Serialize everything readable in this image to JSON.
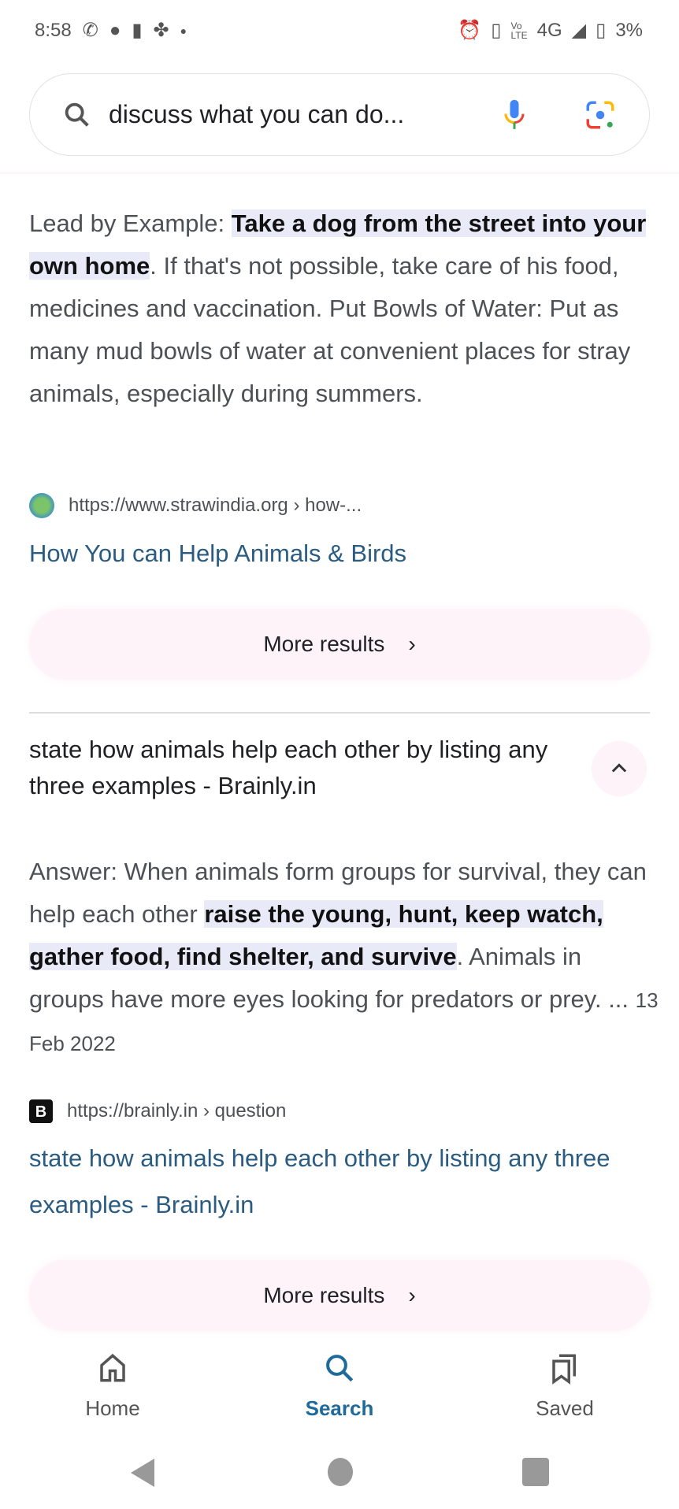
{
  "status_bar": {
    "time": "8:58",
    "network": "4G",
    "battery": "3%"
  },
  "search": {
    "query": "discuss what you can do..."
  },
  "result1": {
    "snippet": {
      "before": "Lead by Example: ",
      "highlight": "Take a dog from the street into your own home",
      "after": ". If that's not possible, take care of his food, medicines and vaccination. Put Bowls of Water: Put as many mud bowls of water at convenient places for stray animals, especially during summers."
    },
    "source_url": "https://www.strawindia.org › how-...",
    "title": "How You can Help Animals & Birds",
    "more_results": "More results"
  },
  "question2": {
    "title": "state how animals help each other by listing any three examples - Brainly.in",
    "snippet": {
      "before": "Answer: When animals form groups for survival, they can help each other ",
      "highlight": "raise the young, hunt, keep watch, gather food, find shelter, and survive",
      "after": ". Animals in groups have more eyes looking for predators or prey. ... ",
      "date": "13 Feb 2022"
    },
    "source_url": "https://brainly.in › question",
    "favicon_letter": "B",
    "more_results": "More results"
  },
  "bottom_nav": [
    {
      "label": "Home",
      "icon": "home-icon"
    },
    {
      "label": "Search",
      "icon": "search-icon",
      "active": true
    },
    {
      "label": "Saved",
      "icon": "bookmarks-icon"
    }
  ],
  "colors": {
    "link": "#2a5c82",
    "active": "#1f6a9a",
    "highlight": "#e8eaf8",
    "button_bg": "#fdf3f8"
  }
}
